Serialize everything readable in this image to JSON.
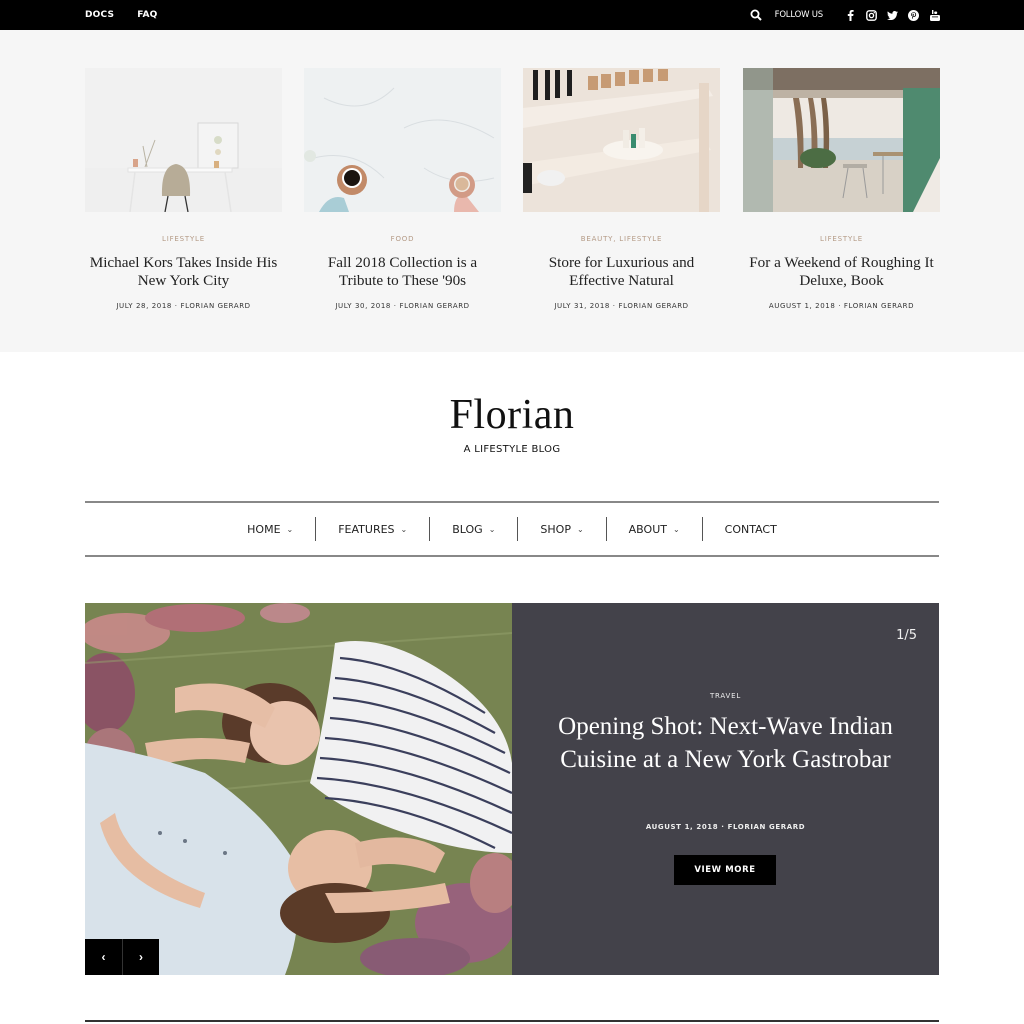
{
  "topbar": {
    "links": [
      "DOCS",
      "FAQ"
    ],
    "follow_label": "FOLLOW US",
    "social_icons": [
      "facebook-icon",
      "instagram-icon",
      "twitter-icon",
      "pinterest-icon",
      "youtube-icon"
    ]
  },
  "featured": [
    {
      "category": "LIFESTYLE",
      "title": "Michael Kors Takes Inside His New York City",
      "date": "JULY 28, 2018",
      "author": "FLORIAN GERARD",
      "image": "white-desk-chair"
    },
    {
      "category": "FOOD",
      "title": "Fall 2018 Collection is a Tribute to These '90s",
      "date": "JULY 30, 2018",
      "author": "FLORIAN GERARD",
      "image": "coffee-cups-marble"
    },
    {
      "category": "BEAUTY, LIFESTYLE",
      "title": "Store for Luxurious and Effective Natural",
      "date": "JULY 31, 2018",
      "author": "FLORIAN GERARD",
      "image": "cosmetics-shelf"
    },
    {
      "category": "LIFESTYLE",
      "title": "For a Weekend of Roughing It Deluxe, Book",
      "date": "AUGUST 1, 2018",
      "author": "FLORIAN GERARD",
      "image": "beach-cafe-interior"
    }
  ],
  "meta_separator": "·",
  "logo": {
    "name": "Florian",
    "tagline": "A LIFESTYLE BLOG"
  },
  "nav": [
    {
      "label": "HOME",
      "dropdown": true
    },
    {
      "label": "FEATURES",
      "dropdown": true
    },
    {
      "label": "BLOG",
      "dropdown": true
    },
    {
      "label": "SHOP",
      "dropdown": true
    },
    {
      "label": "ABOUT",
      "dropdown": true
    },
    {
      "label": "CONTACT",
      "dropdown": false
    }
  ],
  "hero": {
    "counter": "1/5",
    "category": "TRAVEL",
    "title": "Opening Shot: Next-Wave Indian Cuisine at a New York Gastrobar",
    "date": "AUGUST 1, 2018",
    "author": "FLORIAN GERARD",
    "button_label": "VIEW MORE",
    "prev_label": "‹",
    "next_label": "›",
    "image": "two-women-lying-in-flowers"
  },
  "colors": {
    "topbar_bg": "#000000",
    "featured_bg": "#f6f6f6",
    "category_accent": "#b49a86",
    "hero_panel_bg": "#43424a"
  }
}
